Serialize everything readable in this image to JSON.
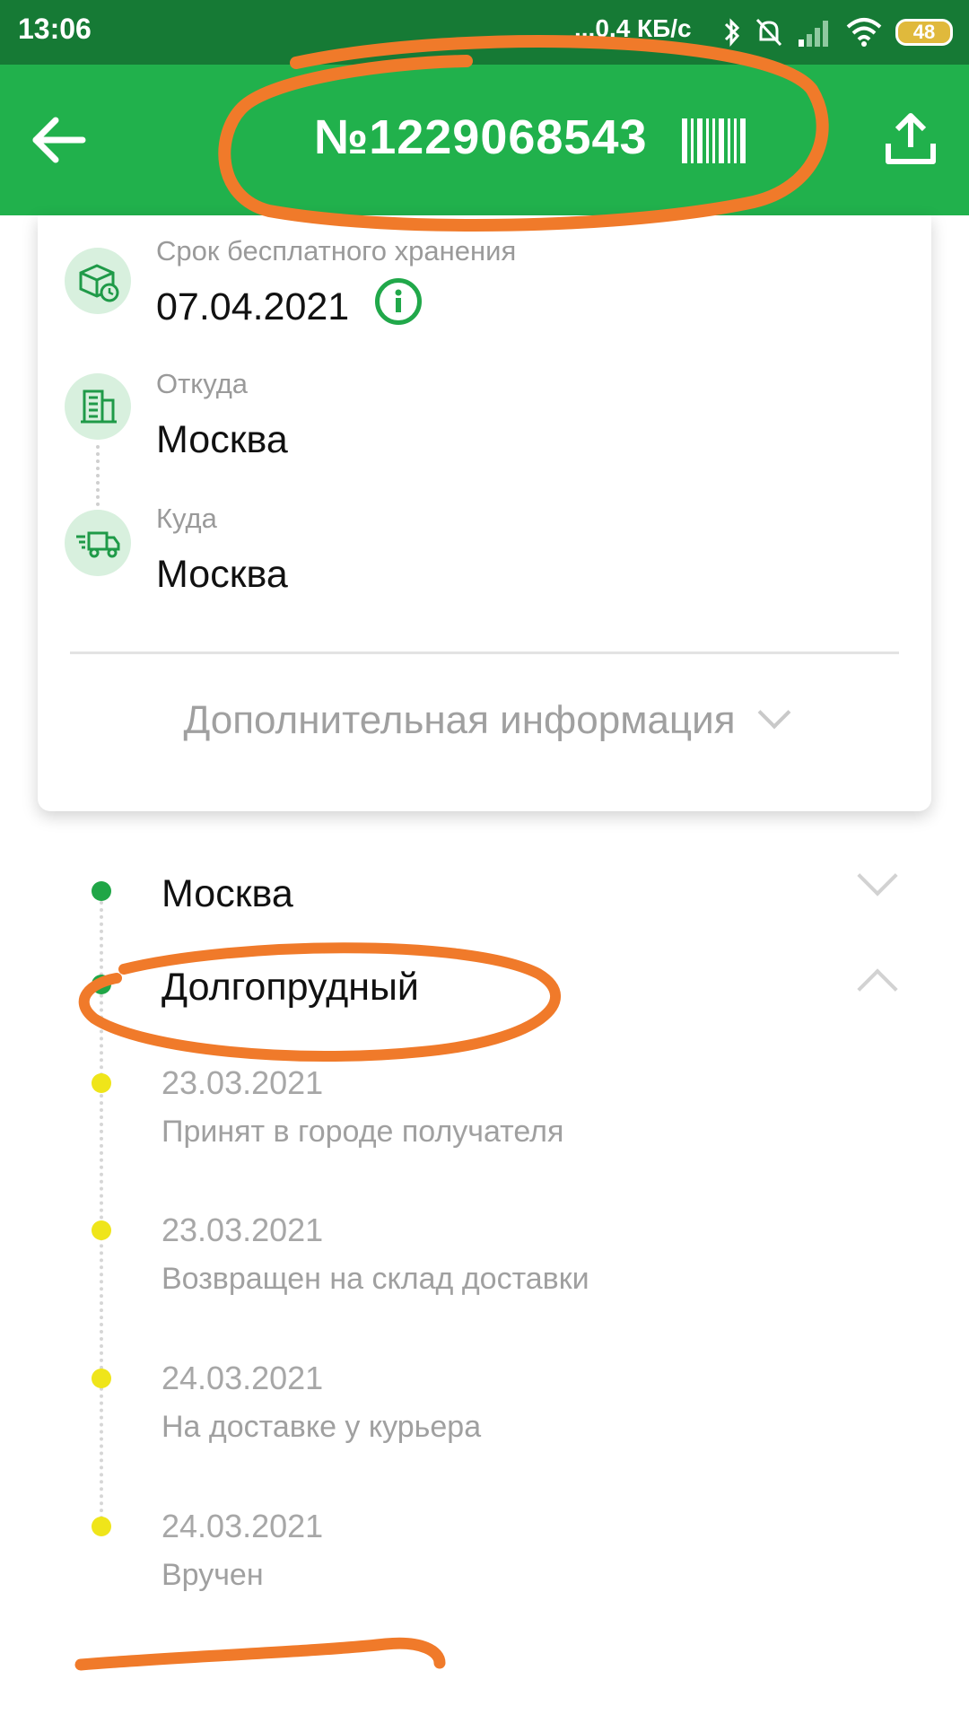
{
  "status_bar": {
    "time": "13:06",
    "net_speed": "...0,4 КБ/с",
    "battery": "48",
    "icons": [
      "bluetooth-icon",
      "mute-icon",
      "signal-icon",
      "wifi-icon",
      "battery-icon"
    ]
  },
  "app_bar": {
    "title": "№1229068543",
    "back_icon": "arrow-left-icon",
    "barcode_icon": "barcode-icon",
    "share_icon": "share-icon",
    "color": "#21b14c"
  },
  "card": {
    "storage": {
      "label": "Срок бесплатного хранения",
      "value": "07.04.2021",
      "icon": "box-clock-icon"
    },
    "from": {
      "label": "Откуда",
      "value": "Москва",
      "icon": "building-icon"
    },
    "to": {
      "label": "Куда",
      "value": "Москва",
      "icon": "truck-icon"
    },
    "more_info": "Дополнительная информация"
  },
  "timeline": {
    "cities": [
      {
        "name": "Москва",
        "expanded": false
      },
      {
        "name": "Долгопрудный",
        "expanded": true
      }
    ],
    "events": [
      {
        "date": "23.03.2021",
        "text": "Принят в городе получателя"
      },
      {
        "date": "23.03.2021",
        "text": "Возвращен на склад доставки"
      },
      {
        "date": "24.03.2021",
        "text": "На доставке у курьера"
      },
      {
        "date": "24.03.2021",
        "text": "Вручен"
      }
    ]
  },
  "colors": {
    "status_bar": "#167a35",
    "accent": "#21b14c",
    "dot_green": "#20a647",
    "dot_yellow": "#efe51a",
    "annotation": "#f07a2a"
  }
}
